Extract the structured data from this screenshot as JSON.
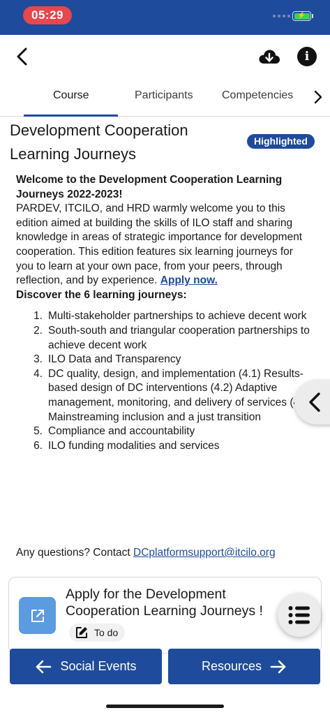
{
  "status_bar": {
    "time": "05:29",
    "battery_state": "charging"
  },
  "header": {
    "back_icon": "chevron-left-icon",
    "download_icon": "cloud-download-icon",
    "info_icon": "info-icon",
    "info_glyph": "i"
  },
  "tabs": [
    {
      "label": "Course",
      "selected": true
    },
    {
      "label": "Participants",
      "selected": false
    },
    {
      "label": "Competencies",
      "selected": false
    }
  ],
  "course": {
    "title_line1": "Development Cooperation",
    "title_line2": "Learning Journeys",
    "badge": "Highlighted"
  },
  "description": {
    "heading": "Welcome to the Development Cooperation Learning Journeys 2022-2023!",
    "body": "PARDEV, ITCILO, and HRD warmly welcome you to this edition aimed at building the skills of ILO staff and sharing knowledge in areas of strategic importance for development cooperation. This edition features six learning journeys for you to learn at your own pace, from your peers, through reflection, and by experience. ",
    "apply_link": "Apply now.",
    "discover_heading": "Discover the 6 learning journeys:",
    "journeys": [
      {
        "num": "1.",
        "text": "Multi-stakeholder partnerships to achieve decent work"
      },
      {
        "num": "2.",
        "text": "South-south and triangular cooperation partnerships to achieve decent work"
      },
      {
        "num": "3.",
        "text": "ILO Data and Transparency"
      },
      {
        "num": "4.",
        "text": "DC quality, design, and implementation (4.1) Results-based design of DC interventions (4.2) Adaptive management, monitoring, and delivery of services (4.3) Mainstreaming inclusion and a just transition"
      },
      {
        "num": "5.",
        "text": "Compliance and accountability"
      },
      {
        "num": "6.",
        "text": "ILO funding modalities and services"
      }
    ],
    "questions_prefix": "Any questions? Contact ",
    "support_email": "DCplatformsupport@itcilo.org"
  },
  "activity": {
    "title": "Apply for the Development Cooperation Learning Journeys !",
    "status": "To do",
    "icon": "external-link-icon"
  },
  "bottom_nav": {
    "prev_label": "Social Events",
    "next_label": "Resources"
  },
  "colors": {
    "brand": "#1e4b9c",
    "time_pill": "#e5484d",
    "activity_icon_bg": "#5b9be0"
  }
}
